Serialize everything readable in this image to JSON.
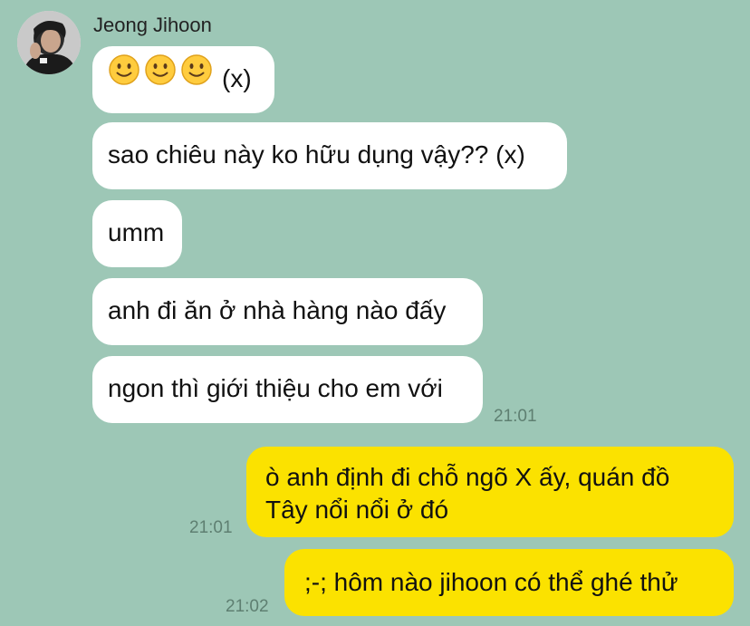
{
  "chat": {
    "sender_name": "Jeong Jihoon",
    "colors": {
      "background": "#9dc7b6",
      "incoming_bubble": "#ffffff",
      "outgoing_bubble": "#fbe200",
      "timestamp": "#5e7f71"
    },
    "incoming": [
      {
        "text": "(x)",
        "emoji_count": 3
      },
      {
        "text": "sao chiêu này ko hữu dụng vậy?? (x)"
      },
      {
        "text": "umm"
      },
      {
        "text": "anh đi ăn ở nhà hàng nào đấy"
      },
      {
        "text": "ngon thì giới thiệu cho em với",
        "time": "21:01"
      }
    ],
    "outgoing": [
      {
        "line1": "ò anh định đi chỗ ngõ X ấy, quán đồ",
        "line2": "Tây nổi nổi ở đó",
        "time": "21:01"
      },
      {
        "text": ";-; hôm nào jihoon có thể ghé thử",
        "time": "21:02"
      }
    ]
  }
}
